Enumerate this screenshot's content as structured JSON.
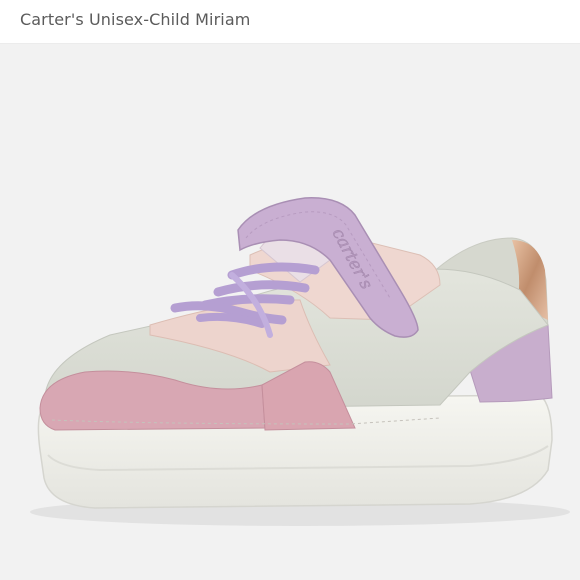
{
  "header": {
    "title": "Carter's Unisex-Child Miriam"
  },
  "product": {
    "logo_text": "carter's",
    "colors": {
      "background": "#f2f2f2",
      "sole": "#f3f3ee",
      "body": "#dcdfd6",
      "pink": "#d8a6b2",
      "lavender": "#c9aed0",
      "laces": "#bba6d6",
      "peach": "#edd3cc",
      "gold": "#d3a889"
    }
  }
}
